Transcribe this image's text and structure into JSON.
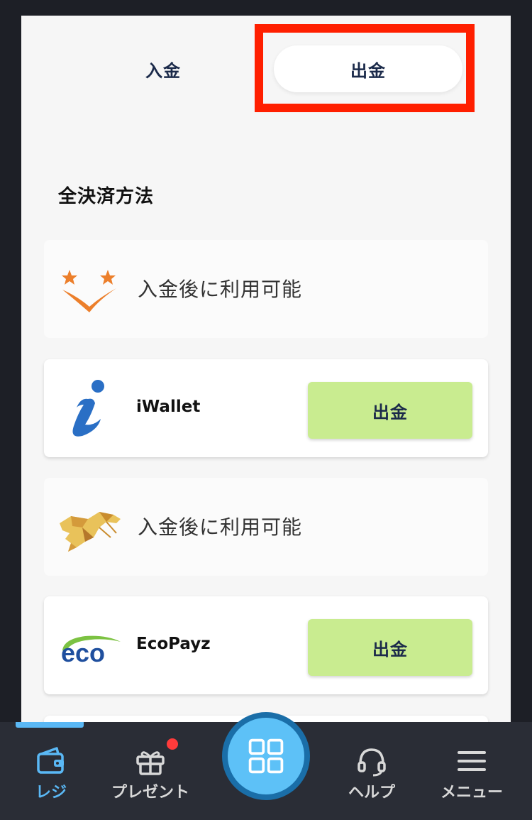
{
  "tabs": {
    "deposit": "入金",
    "withdraw": "出金"
  },
  "section_title": "全決済方法",
  "methods": [
    {
      "note": "入金後に利用可能",
      "logo_icon": "star-v-logo-icon"
    },
    {
      "name": "iWallet",
      "button": "出金",
      "logo_icon": "iwallet-logo-icon"
    },
    {
      "note": "入金後に利用可能",
      "logo_icon": "tiger-logo-icon"
    },
    {
      "name": "EcoPayz",
      "button": "出金",
      "logo_icon": "ecopayz-logo-icon",
      "logo_text": "eco"
    }
  ],
  "nav": {
    "items": [
      {
        "label": "レジ",
        "icon": "wallet-icon",
        "active": true
      },
      {
        "label": "プレゼント",
        "icon": "gift-icon"
      },
      {
        "label": "ヘルプ",
        "icon": "headset-icon"
      },
      {
        "label": "メニュー",
        "icon": "hamburger-icon"
      }
    ],
    "center_icon": "grid-icon"
  },
  "colors": {
    "highlight": "#ff1f00",
    "withdraw_button": "#c9ec90",
    "accent": "#5ab8f5",
    "badge": "#ff3b3b"
  }
}
